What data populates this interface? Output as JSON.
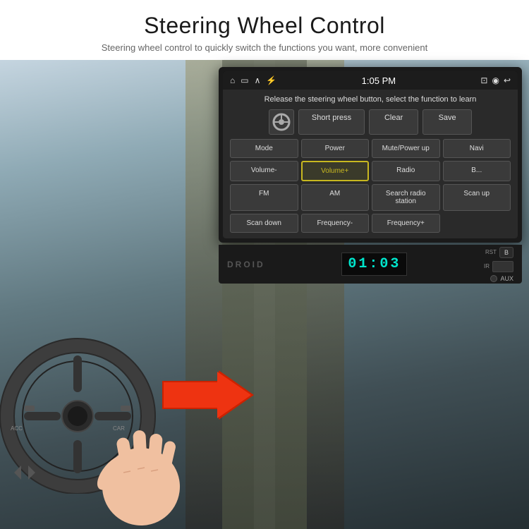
{
  "header": {
    "title": "Steering Wheel Control",
    "subtitle": "Steering wheel control to quickly switch the functions you want, more convenient"
  },
  "status_bar": {
    "time": "1:05 PM",
    "icons_left": [
      "home",
      "screen",
      "up-arrow",
      "usb"
    ],
    "icons_right": [
      "cast",
      "location",
      "back"
    ]
  },
  "screen": {
    "instruction": "Release the steering wheel button, select the function to learn",
    "top_buttons": [
      {
        "label": "Short press",
        "highlighted": false
      },
      {
        "label": "Clear",
        "highlighted": false
      },
      {
        "label": "Save",
        "highlighted": false
      }
    ],
    "grid_buttons": [
      {
        "label": "Mode",
        "highlighted": false
      },
      {
        "label": "Power",
        "highlighted": false
      },
      {
        "label": "Mute/Power up",
        "highlighted": false
      },
      {
        "label": "Navi",
        "highlighted": false
      },
      {
        "label": "Volume-",
        "highlighted": false
      },
      {
        "label": "Volume+",
        "highlighted": true
      },
      {
        "label": "Radio",
        "highlighted": false
      },
      {
        "label": "B...",
        "highlighted": false
      },
      {
        "label": "FM",
        "highlighted": false
      },
      {
        "label": "AM",
        "highlighted": false
      },
      {
        "label": "Search radio station",
        "highlighted": false
      },
      {
        "label": "Scan up",
        "highlighted": false
      },
      {
        "label": "Scan down",
        "highlighted": false
      },
      {
        "label": "Frequency-",
        "highlighted": false
      },
      {
        "label": "Frequency+",
        "highlighted": false
      }
    ]
  },
  "hardware": {
    "clock": "01:03",
    "labels": {
      "rst": "RST",
      "b_button": "B",
      "ir": "IR",
      "aux": "AUX"
    }
  },
  "colors": {
    "highlight_border": "#c8b820",
    "clock_color": "#00e5cc",
    "screen_bg": "#2a2a2a",
    "btn_bg": "#3a3a3a"
  }
}
